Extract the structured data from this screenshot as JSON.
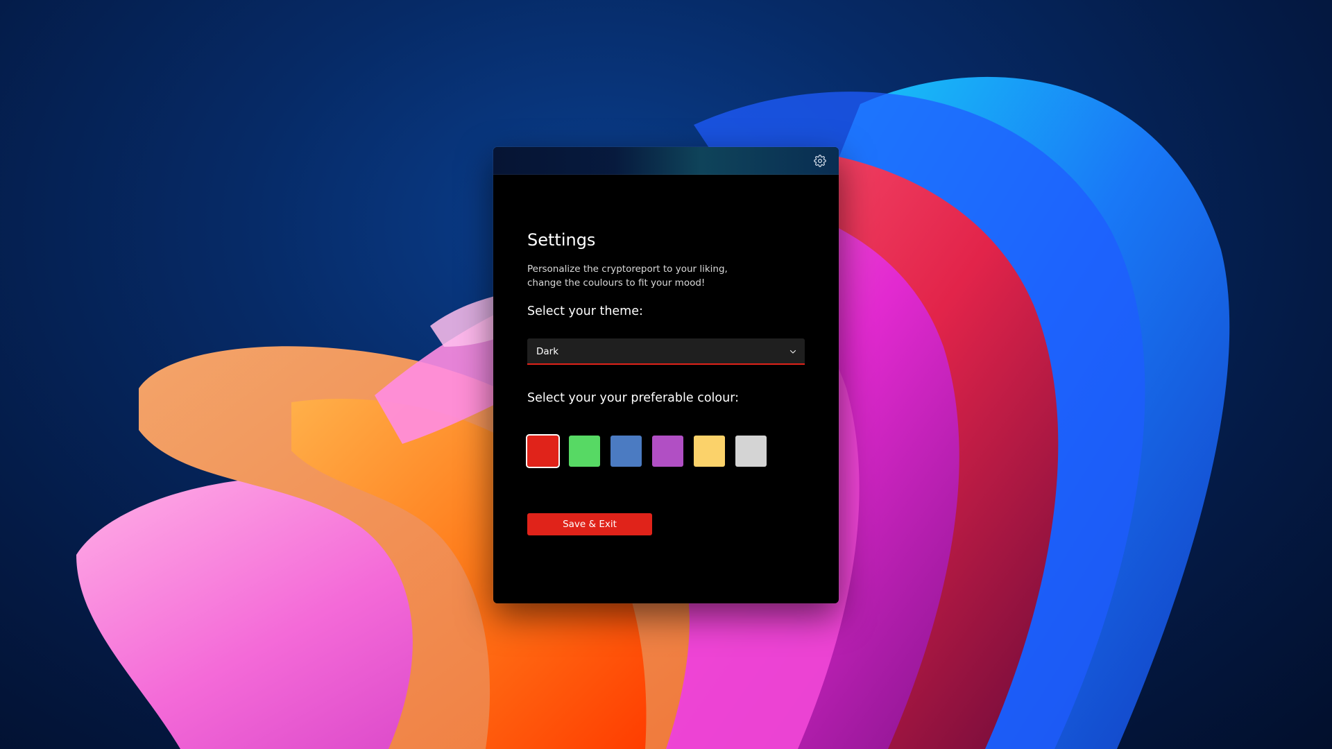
{
  "window": {
    "title": "Settings",
    "description_line1": "Personalize the cryptoreport to your liking,",
    "description_line2": "change the coulours to fit your mood!",
    "settings_icon": "gear-icon"
  },
  "theme": {
    "label": "Select your theme:",
    "selected": "Dark",
    "chevron_icon": "chevron-down-icon"
  },
  "colour": {
    "label": "Select your your preferable colour:",
    "swatches": [
      {
        "name": "red",
        "hex": "#e0231a",
        "selected": true
      },
      {
        "name": "green",
        "hex": "#57d964",
        "selected": false
      },
      {
        "name": "blue",
        "hex": "#4b7bc2",
        "selected": false
      },
      {
        "name": "purple",
        "hex": "#b14fc4",
        "selected": false
      },
      {
        "name": "yellow",
        "hex": "#fbd26a",
        "selected": false
      },
      {
        "name": "grey",
        "hex": "#d4d4d4",
        "selected": false
      }
    ]
  },
  "actions": {
    "save_label": "Save & Exit"
  },
  "colors": {
    "accent": "#e0231a",
    "window_bg": "#000000",
    "dropdown_bg": "#1f1f1f"
  }
}
